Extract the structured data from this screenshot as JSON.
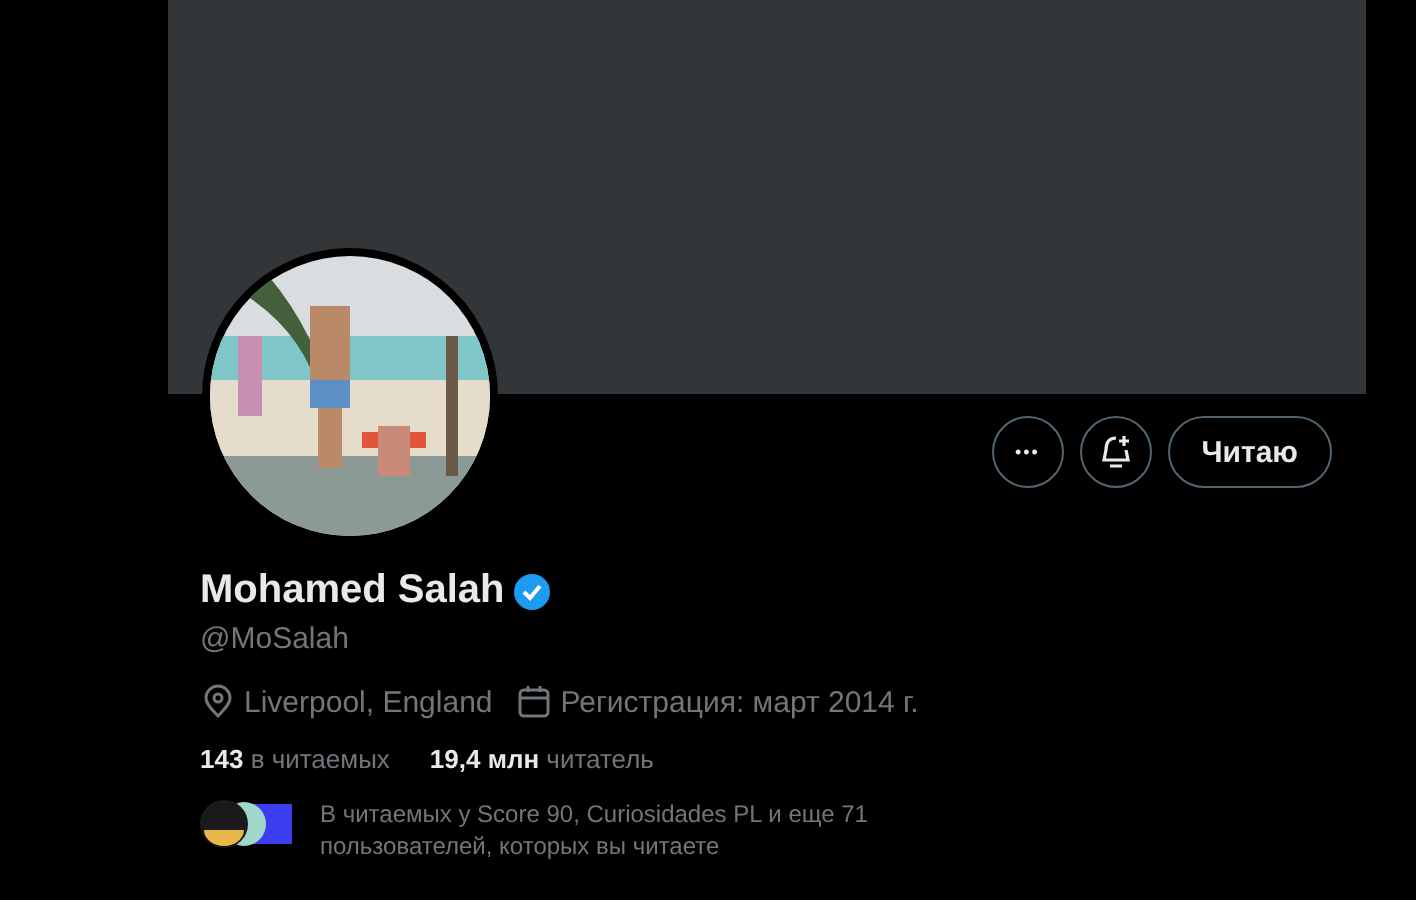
{
  "actions": {
    "more": "•••",
    "follow_button": "Читаю"
  },
  "profile": {
    "name": "Mohamed Salah",
    "verified": true,
    "handle": "@MoSalah",
    "location": "Liverpool, England",
    "joined": "Регистрация: март 2014 г."
  },
  "stats": [
    {
      "text": "**143** в читаемых"
    },
    {
      "text": "**19,4 млн** читатель"
    }
  ],
  "followed_by": "В читаемых у Score 90, Curiosidades PL и еще 71 пользователей, которых вы читаете"
}
